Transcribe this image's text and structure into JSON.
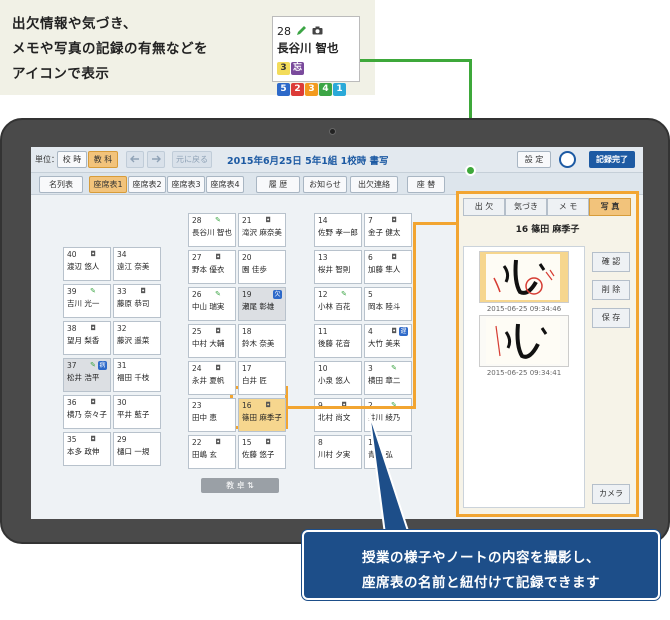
{
  "caption_top": {
    "line1": "出欠情報や気づき、",
    "line2": "メモや写真の記録の有無などを",
    "line3": "アイコンで表示"
  },
  "legend": {
    "number": "28",
    "name": "長谷川 智也",
    "badges_row1": [
      "3",
      "忘"
    ],
    "badges_row2": [
      "5",
      "2",
      "3",
      "4",
      "1"
    ]
  },
  "appbar": {
    "unit_label": "単位：",
    "btn_school_hour": "校 時",
    "btn_subject": "教 科",
    "btn_back": "元に戻る",
    "title": "2015年6月25日 5年1組  1校時  書写",
    "btn_settings": "設 定",
    "btn_done": "記録完了"
  },
  "tabrow": {
    "tabs": [
      "名列表",
      "座席表1",
      "座席表2",
      "座席表3",
      "座席表4"
    ],
    "btn_history": "履 歴",
    "btn_notice": "お知らせ",
    "btn_contact": "出欠連絡",
    "btn_swap": "座 替"
  },
  "seats": [
    {
      "num": "40",
      "name": "渡辺 悠人",
      "icon": "camera-icon"
    },
    {
      "num": "34",
      "name": "遠江 奈美",
      "icon": ""
    },
    {
      "num": "39",
      "name": "吉川 光一",
      "icon": "pencil-icon"
    },
    {
      "num": "33",
      "name": "藤原 恭司",
      "icon": "camera-icon"
    },
    {
      "num": "38",
      "name": "望月 梨香",
      "icon": "camera-icon"
    },
    {
      "num": "32",
      "name": "藤沢 遥菜",
      "icon": ""
    },
    {
      "num": "37",
      "name": "松井 浩平",
      "icon": "pencil-icon",
      "tag": "病"
    },
    {
      "num": "31",
      "name": "福田 千枝",
      "icon": ""
    },
    {
      "num": "36",
      "name": "横乃 奈々子",
      "icon": "camera-icon"
    },
    {
      "num": "30",
      "name": "平井 藍子",
      "icon": ""
    },
    {
      "num": "35",
      "name": "本多 政伸",
      "icon": "camera-icon"
    },
    {
      "num": "29",
      "name": "樋口 一規",
      "icon": ""
    },
    {
      "num": "28",
      "name": "長谷川 智也",
      "icon": "pencil-icon"
    },
    {
      "num": "21",
      "name": "滝沢 麻奈美",
      "icon": "camera-icon"
    },
    {
      "num": "27",
      "name": "野本 優衣",
      "icon": "camera-icon"
    },
    {
      "num": "20",
      "name": "園 佳歩",
      "icon": ""
    },
    {
      "num": "26",
      "name": "中山 瑞実",
      "icon": "pencil-icon"
    },
    {
      "num": "19",
      "name": "瀬尾 彰雄",
      "icon": "",
      "tag": "欠"
    },
    {
      "num": "25",
      "name": "中村 大輔",
      "icon": "camera-icon"
    },
    {
      "num": "18",
      "name": "鈴木 奈美",
      "icon": ""
    },
    {
      "num": "24",
      "name": "永井 夏帆",
      "icon": "camera-icon"
    },
    {
      "num": "17",
      "name": "白井 匠",
      "icon": ""
    },
    {
      "num": "23",
      "name": "田中 恵",
      "icon": ""
    },
    {
      "num": "16",
      "name": "篠田 麻季子",
      "icon": "camera-icon"
    },
    {
      "num": "22",
      "name": "田嶋 玄",
      "icon": "camera-icon"
    },
    {
      "num": "15",
      "name": "佐藤 悠子",
      "icon": "camera-icon"
    },
    {
      "num": "14",
      "name": "佐野 孝一郎",
      "icon": ""
    },
    {
      "num": "7",
      "name": "金子 健太",
      "icon": "camera-icon"
    },
    {
      "num": "13",
      "name": "桜井 智則",
      "icon": ""
    },
    {
      "num": "6",
      "name": "加藤 隼人",
      "icon": "camera-icon"
    },
    {
      "num": "12",
      "name": "小林 百花",
      "icon": "pencil-icon"
    },
    {
      "num": "5",
      "name": "岡本 陸斗",
      "icon": ""
    },
    {
      "num": "11",
      "name": "後藤 花音",
      "icon": ""
    },
    {
      "num": "4",
      "name": "大竹 美来",
      "icon": "camera-icon",
      "tag": "遅"
    },
    {
      "num": "10",
      "name": "小泉 悠人",
      "icon": ""
    },
    {
      "num": "3",
      "name": "横田 章二",
      "icon": "pencil-icon"
    },
    {
      "num": "9",
      "name": "北村 尚文",
      "icon": "camera-icon"
    },
    {
      "num": "2",
      "name": "井川 綾乃",
      "icon": "pencil-icon"
    },
    {
      "num": "8",
      "name": "川村 夕実",
      "icon": ""
    },
    {
      "num": "1",
      "name": "青木 弘",
      "icon": ""
    }
  ],
  "seat_bottom_btn": "教 卓 ⇅",
  "panel": {
    "tabs": [
      "出 欠",
      "気づき",
      "メ モ",
      "写 真"
    ],
    "student": "16  篠田 麻季子",
    "photos": [
      {
        "timestamp": "2015-06-25 09:34:46"
      },
      {
        "timestamp": "2015-06-25 09:34:41"
      }
    ],
    "btn_confirm": "確 認",
    "btn_delete": "削 除",
    "btn_save": "保 存",
    "btn_camera": "カメラ"
  },
  "callout": {
    "line1": "授業の様子やノートの内容を撮影し、",
    "line2": "座席表の名前と紐付けて記録できます"
  },
  "colors": {
    "accent_orange": "#f2a531",
    "accent_green": "#3ea83a",
    "brand_blue": "#1d5aa3",
    "callout_blue": "#1d4e89"
  }
}
